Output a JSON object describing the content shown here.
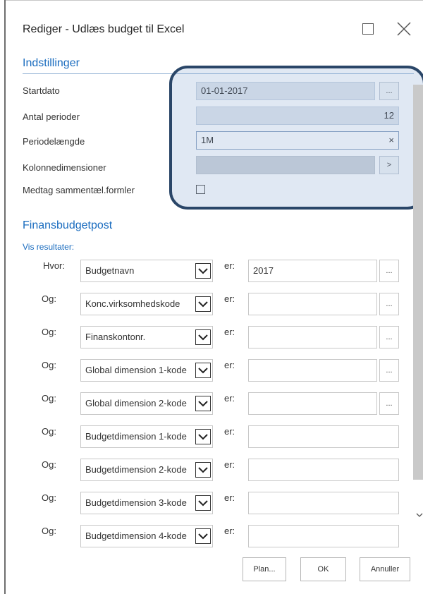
{
  "window": {
    "title": "Rediger - Udlæs budget til Excel"
  },
  "indstillinger": {
    "heading": "Indstillinger",
    "fields": [
      {
        "label": "Startdato",
        "value": "01-01-2017",
        "button": "..."
      },
      {
        "label": "Antal perioder",
        "value": "12"
      },
      {
        "label": "Periodelængde",
        "value": "1M",
        "clear": "×"
      },
      {
        "label": "Kolonnedimensioner",
        "value": "",
        "button": ">"
      },
      {
        "label": "Medtag sammentæl.formler",
        "checked": false
      }
    ]
  },
  "finansbudgetpost": {
    "heading": "Finansbudgetpost",
    "vis_resultater": "Vis resultater:",
    "er_label": "er:",
    "rows": [
      {
        "prefix": "Hvor:",
        "field": "Budgetnavn",
        "value": "2017",
        "has_lookup": true
      },
      {
        "prefix": "Og:",
        "field": "Konc.virksomhedskode",
        "value": "",
        "has_lookup": true
      },
      {
        "prefix": "Og:",
        "field": "Finanskontonr.",
        "value": "",
        "has_lookup": true
      },
      {
        "prefix": "Og:",
        "field": "Global dimension 1-kode",
        "value": "",
        "has_lookup": true
      },
      {
        "prefix": "Og:",
        "field": "Global dimension 2-kode",
        "value": "",
        "has_lookup": true
      },
      {
        "prefix": "Og:",
        "field": "Budgetdimension 1-kode",
        "value": "",
        "has_lookup": false
      },
      {
        "prefix": "Og:",
        "field": "Budgetdimension 2-kode",
        "value": "",
        "has_lookup": false
      },
      {
        "prefix": "Og:",
        "field": "Budgetdimension 3-kode",
        "value": "",
        "has_lookup": false
      },
      {
        "prefix": "Og:",
        "field": "Budgetdimension 4-kode",
        "value": "",
        "has_lookup": false
      }
    ],
    "lookup_label": "..."
  },
  "buttons": {
    "plan": "Plan...",
    "ok": "OK",
    "cancel": "Annuller"
  },
  "colors": {
    "accent": "#1a6cbf",
    "highlight_border": "#2a4668"
  }
}
